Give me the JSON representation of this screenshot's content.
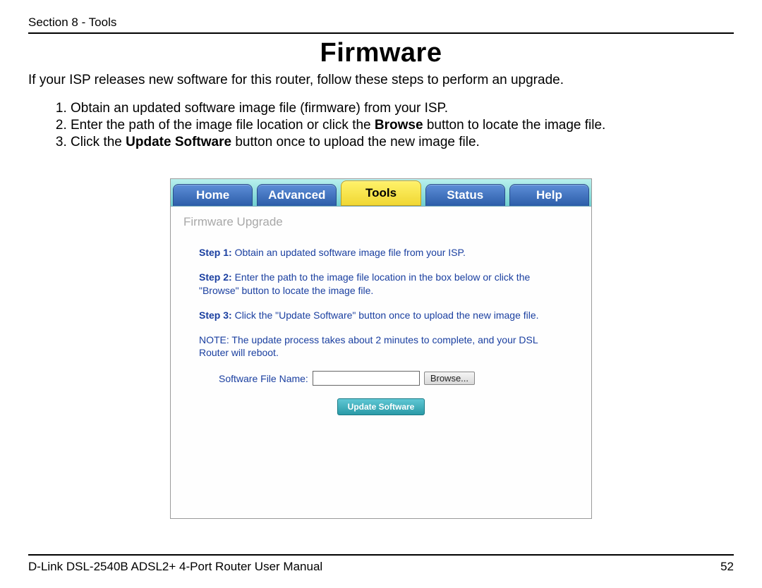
{
  "header": {
    "section": "Section 8 - Tools"
  },
  "title": "Firmware",
  "intro": "If your ISP releases new software for this router, follow these steps to perform an upgrade.",
  "steps": {
    "s1": "Obtain an updated software image file (firmware) from your ISP.",
    "s2a": "Enter the path of the image file location or click the ",
    "s2b": "Browse",
    "s2c": " button to locate the image file.",
    "s3a": "Click the ",
    "s3b": "Update Software",
    "s3c": " button once to upload the new image file."
  },
  "router": {
    "tabs": {
      "home": "Home",
      "advanced": "Advanced",
      "tools": "Tools",
      "status": "Status",
      "help": "Help"
    },
    "active_tab": "Tools",
    "panel_title": "Firmware Upgrade",
    "step1_label": "Step 1:",
    "step1_text": " Obtain an updated software image file from your ISP.",
    "step2_label": "Step 2:",
    "step2_text": " Enter the path to the image file location in the box below or click the \"Browse\" button to locate the image file.",
    "step3_label": "Step 3:",
    "step3_text": " Click the \"Update Software\" button once to upload the new image file.",
    "note": "NOTE: The update process takes about 2 minutes to complete, and your DSL Router will reboot.",
    "file_label": "Software File Name:",
    "browse_label": "Browse...",
    "update_label": "Update Software"
  },
  "footer": {
    "left": "D-Link DSL-2540B ADSL2+ 4-Port Router User Manual",
    "page": "52"
  }
}
